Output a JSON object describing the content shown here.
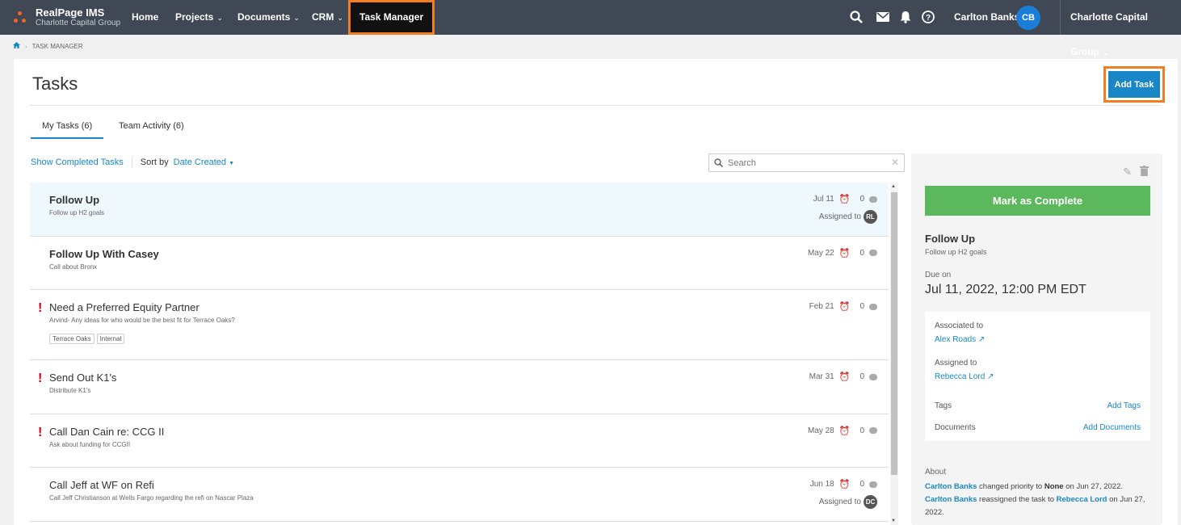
{
  "nav": {
    "brand": "RealPage IMS",
    "brand_sub": "Charlotte Capital Group",
    "items": [
      {
        "label": "Home"
      },
      {
        "label": "Projects"
      },
      {
        "label": "Documents"
      },
      {
        "label": "CRM"
      },
      {
        "label": "Task Manager"
      }
    ],
    "user_name": "Carlton Banks",
    "user_initials": "CB",
    "org": "Charlotte Capital Group"
  },
  "breadcrumb": {
    "current": "TASK MANAGER"
  },
  "page": {
    "title": "Tasks",
    "add_task_label": "Add Task",
    "tabs": [
      {
        "label": "My Tasks (6)"
      },
      {
        "label": "Team Activity (6)"
      }
    ],
    "show_completed": "Show Completed Tasks",
    "sort_by": "Sort by",
    "sort_value": "Date Created",
    "search_placeholder": "Search"
  },
  "tasks": [
    {
      "title": "Follow Up",
      "desc": "Follow up H2 goals",
      "date": "Jul 11",
      "comments": "0",
      "assigned_label": "Assigned to",
      "assignee": "RL"
    },
    {
      "title": "Follow Up With Casey",
      "desc": "Call about Bronx",
      "date": "May 22",
      "comments": "0"
    },
    {
      "title": "Need a Preferred Equity Partner",
      "desc": "Arvind- Any ideas for who would be the best fit for Terrace Oaks?",
      "date": "Feb 21",
      "comments": "0",
      "tags": [
        "Terrace Oaks",
        "Internal"
      ]
    },
    {
      "title": "Send Out K1's",
      "desc": "Distribute K1's",
      "date": "Mar 31",
      "comments": "0"
    },
    {
      "title": "Call Dan Cain re: CCG II",
      "desc": "Ask about funding for CCGII",
      "date": "May 28",
      "comments": "0"
    },
    {
      "title": "Call Jeff at WF on Refi",
      "desc": "Call Jeff Christianson at Wells Fargo regarding the refi on Nascar Plaza",
      "date": "Jun 18",
      "comments": "0",
      "assigned_label": "Assigned to",
      "assignee": "DC"
    }
  ],
  "detail": {
    "complete_label": "Mark as Complete",
    "title": "Follow Up",
    "desc": "Follow up H2 goals",
    "due_label": "Due on",
    "due": "Jul 11, 2022, 12:00 PM EDT",
    "associated_label": "Associated to",
    "associated": "Alex Roads ↗",
    "assigned_label": "Assigned to",
    "assigned": "Rebecca Lord ↗",
    "tags_label": "Tags",
    "add_tags": "Add Tags",
    "documents_label": "Documents",
    "add_documents": "Add Documents",
    "about_label": "About",
    "activity": [
      {
        "who": "Carlton Banks",
        "t1": " changed priority to ",
        "b": "None",
        "t2": " on Jun 27, 2022."
      },
      {
        "who": "Carlton Banks",
        "t1": " reassigned the task to ",
        "link": "Rebecca Lord",
        "t2": " on Jun 27, 2022."
      }
    ]
  },
  "colors": {
    "accent": "#1987c5",
    "highlight": "#f07d22",
    "complete": "#5cb85c",
    "priority": "#d0021b"
  }
}
